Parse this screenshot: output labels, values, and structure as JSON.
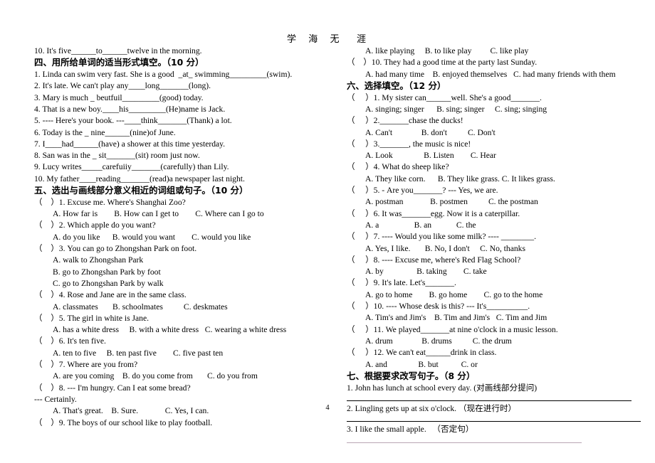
{
  "document": {
    "header_title": "学  海  无   涯",
    "page_number": "4"
  },
  "left_column": {
    "carryover_line": "10. It's five______to______twelve in the morning.",
    "section_four": {
      "heading": "四、用所给单词的适当形式填空。（10 分）",
      "items": [
        "1. Linda can swim very fast. She is a good  _at_ swimming_________(swim).",
        "2. It's late. We can't play any____long_______(long).",
        "3. Mary is much _ beutfuil_________(good) today.",
        "4. That is a new boy.____his_________(He)name is Jack.",
        "5. ---- Here's your book. ---____think_______(Thank) a lot.",
        "6. Today is the _ nine______(nine)of June.",
        "7. I____had______(have) a shower at this time yesterday.",
        "8. San was in the _ sit_______(sit) room just now.",
        "9. Lucy writes_____carefuiiy_______(carefully) than Lily.",
        "10. My father____reading_______(read)a newspaper last night."
      ]
    },
    "section_five": {
      "heading": "五、选出与画线部分意义相近的词组或句子。（10 分）",
      "questions": [
        {
          "stem": "（    ）1. Excuse me. Where's Shanghai Zoo?",
          "options": [
            "A. How far is        B. How can I get to        C. Where can I go to"
          ]
        },
        {
          "stem": "（    ）2. Which apple do you want?",
          "options": [
            "A. do you like      B. would you want        C. would you like"
          ]
        },
        {
          "stem": "（    ）3. You can go to Zhongshan Park on foot.",
          "options": [
            "A. walk to Zhongshan Park",
            "B. go to Zhongshan Park by foot",
            "C. go to Zhongshan Park by walk"
          ]
        },
        {
          "stem": "（    ）4. Rose and Jane are in the same class.",
          "options": [
            "A. classmates       B. schoolmates          C. deskmates"
          ]
        },
        {
          "stem": "（    ）5. The girl in white is Jane.",
          "options": [
            "A. has a white dress     B. with a white dress   C. wearing a white dress"
          ]
        },
        {
          "stem": "（    ）6. It's ten five.",
          "options": [
            "A. ten to five     B. ten past five        C. five past ten"
          ]
        },
        {
          "stem": "（    ）7. Where are you from?",
          "options": [
            "A. are you coming    B. do you come from       C. do you from"
          ]
        },
        {
          "stem": "（    ）8. --- I'm hungry. Can I eat some bread?",
          "continuation": "--- Certainly.",
          "options": [
            "A. That's great.    B. Sure.             C. Yes, I can."
          ]
        },
        {
          "stem": "（    ）9. The boys of our school like to play football.",
          "options": []
        }
      ]
    }
  },
  "right_column": {
    "carryover_options": "A. like playing     B. to like play         C. like play",
    "carryover_q10_stem": "（    ）10. They had a good time at the party last Sunday.",
    "carryover_q10_options": "A. had many time    B. enjoyed themselves   C. had many friends with them",
    "section_six": {
      "heading": "六、选择填空。（12 分）",
      "questions": [
        {
          "stem": "（     ）1. My sister can______well. She's a good_______.",
          "options": "A. singing; singer      B. sing; singer     C. sing; singing"
        },
        {
          "stem": "（     ）2._______chase the ducks!",
          "options": "A. Can't              B. don't          C. Don't"
        },
        {
          "stem": "（     ）3._______, the music is nice!",
          "options": "A. Look               B. Listen        C. Hear"
        },
        {
          "stem": "（     ）4. What do sheep like?",
          "options": "A. They like corn.      B. They like grass. C. It likes grass."
        },
        {
          "stem": "（     ）5. - Are you_______? --- Yes, we are.",
          "options": "A. postman             B. postmen          C. the postman"
        },
        {
          "stem": "（     ）6. It was_______egg. Now it is a caterpillar.",
          "options": "A. a                 B. an            C. the"
        },
        {
          "stem": "（     ）7. ---- Would you like some milk? ---- ________.",
          "options": "A. Yes, I like.       B. No, I don't     C. No, thanks"
        },
        {
          "stem": "（     ）8. ---- Excuse me, where's Red Flag School?",
          "options": "A. by                B. taking        C. take"
        },
        {
          "stem": "（     ）9. It's late. Let's_______.",
          "options": "A. go to home        B. go home        C. go to the home"
        },
        {
          "stem": "（     ）10. ---- Whose desk is this? --- It's__________.",
          "options": "A. Tim's and Jim's    B. Tim and Jim's   C. Tim and Jim"
        },
        {
          "stem": "（     ）11. We played_______at nine o'clock in a music lesson.",
          "options": "A. drum              B. drums          C. the drum"
        },
        {
          "stem": "（     ）12. We can't eat______drink in class.",
          "options": "A. and               B. but           C. or"
        }
      ]
    },
    "section_seven": {
      "heading": "七、根据要求改写句子。（8 分）",
      "items": [
        "1. John has lunch at school every day. (对画线部分提问)",
        "2. Lingling gets up at six o'clock. （现在进行时）",
        "3. I like the small apple.   （否定句）"
      ]
    }
  }
}
